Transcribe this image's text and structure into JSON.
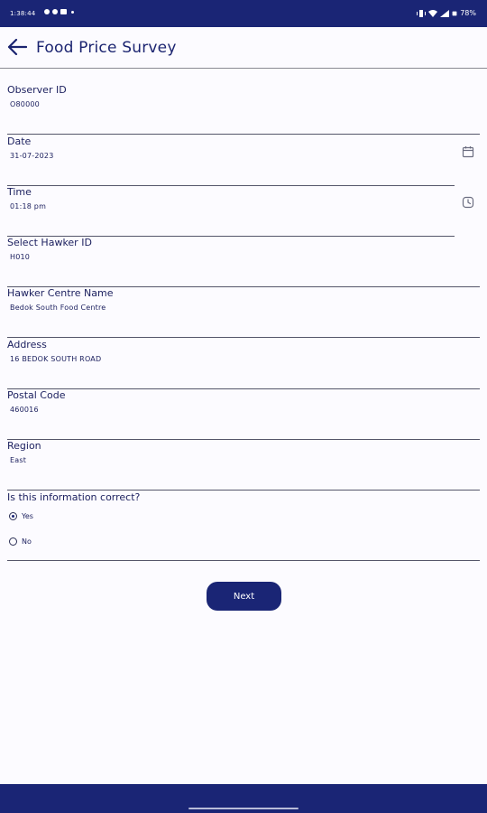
{
  "status_bar": {
    "time": "1:38:44",
    "battery": "78%"
  },
  "header": {
    "title": "Food Price Survey",
    "back_icon": "arrow-left-icon"
  },
  "form": {
    "fields": [
      {
        "label": "Observer ID",
        "value": "O80000"
      },
      {
        "label": "Date",
        "value": "31-07-2023",
        "icon": "calendar-icon"
      },
      {
        "label": "Time",
        "value": "01:18 pm",
        "icon": "clock-icon"
      },
      {
        "label": "Select Hawker ID",
        "value": "H010"
      },
      {
        "label": "Hawker Centre Name",
        "value": "Bedok South Food Centre"
      },
      {
        "label": "Address",
        "value": "16 BEDOK SOUTH ROAD"
      },
      {
        "label": "Postal Code",
        "value": "460016"
      },
      {
        "label": "Region",
        "value": "East"
      }
    ],
    "question": "Is this information correct?",
    "options": [
      {
        "label": "Yes",
        "selected": true
      },
      {
        "label": "No",
        "selected": false
      }
    ],
    "next_label": "Next"
  },
  "colors": {
    "primary": "#1a2575",
    "background": "#fcfbff",
    "text": "#1b1f5e"
  }
}
